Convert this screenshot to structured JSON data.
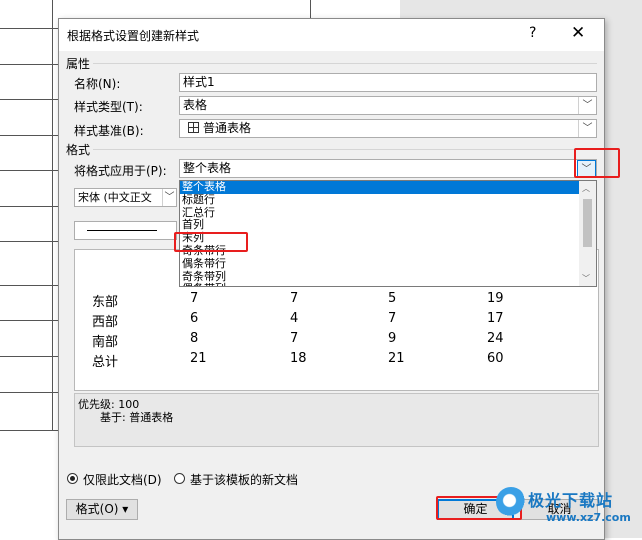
{
  "dialog": {
    "title": "根据格式设置创建新样式",
    "help": "?",
    "close": "✕"
  },
  "properties": {
    "section": "属性",
    "name_label": "名称(N):",
    "name_value": "样式1",
    "type_label": "样式类型(T):",
    "type_value": "表格",
    "based_label": "样式基准(B):",
    "based_value": "普通表格"
  },
  "format": {
    "section": "格式",
    "apply_label": "将格式应用于(P):",
    "apply_value": "整个表格",
    "font_value": "宋体 (中文正文",
    "options": [
      "整个表格",
      "标题行",
      "汇总行",
      "首列",
      "末列",
      "奇条带行",
      "偶条带行",
      "奇条带列",
      "偶条带列"
    ],
    "selected_index": 0,
    "highlighted_option": "奇条带行"
  },
  "preview": {
    "rows": [
      [
        "东部",
        "7",
        "7",
        "5",
        "19"
      ],
      [
        "西部",
        "6",
        "4",
        "7",
        "17"
      ],
      [
        "南部",
        "8",
        "7",
        "9",
        "24"
      ],
      [
        "总计",
        "21",
        "18",
        "21",
        "60"
      ]
    ]
  },
  "description": {
    "priority": "优先级: 100",
    "based_on": "基于: 普通表格"
  },
  "footer": {
    "radio_doc_only": "仅限此文档(D)",
    "radio_template": "基于该模板的新文档",
    "format_button": "格式(O) ▾",
    "ok_button": "确定",
    "cancel_button": "取消"
  },
  "watermark": {
    "brand": "极光下载站",
    "url": "www.xz7.com"
  },
  "colors": {
    "selection": "#0078d7",
    "highlight": "#e81e1e",
    "dialog_bg": "#f0f0f0"
  }
}
